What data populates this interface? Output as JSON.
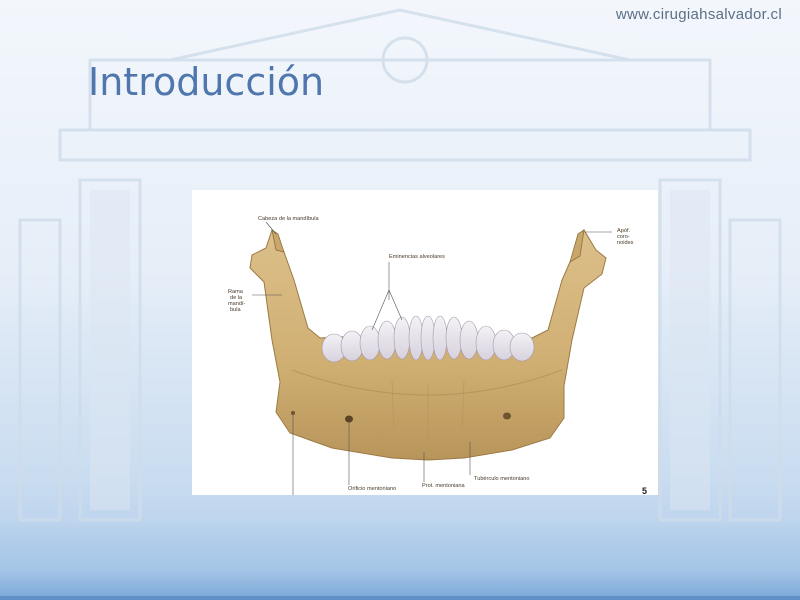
{
  "header": {
    "url": "www.cirugiahsalvador.cl"
  },
  "slide": {
    "title": "Introducción"
  },
  "figure": {
    "labels": {
      "head": "Cabeza de la mandíbula",
      "alveolar": "Eminencias alveolares",
      "coronoid_1": "Apóf.",
      "coronoid_2": "coro-",
      "coronoid_3": "noides",
      "ramus_1": "Rama",
      "ramus_2": "de la",
      "ramus_3": "mandí-",
      "ramus_4": "bula",
      "foramen": "Orificio mentoniano",
      "protuberance": "Prot. mentoniana",
      "tubercle": "Tubérculo mentoniano"
    },
    "figure_number": "5"
  }
}
